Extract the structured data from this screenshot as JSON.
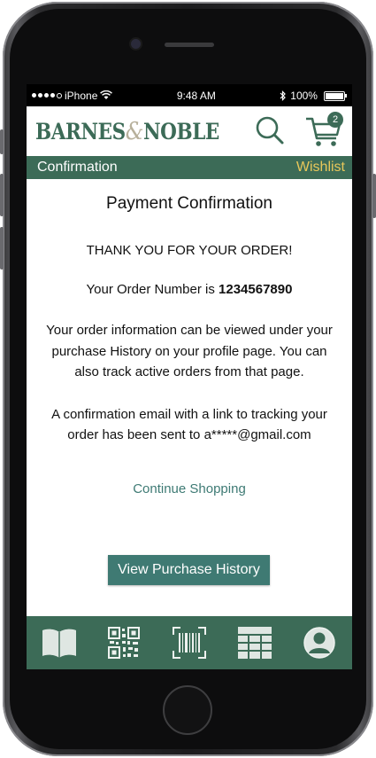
{
  "status_bar": {
    "carrier": "iPhone",
    "time": "9:48 AM",
    "battery": "100%"
  },
  "header": {
    "logo_part1": "BARNES",
    "logo_amp": "&",
    "logo_part2": "NOBLE",
    "cart_count": "2"
  },
  "subnav": {
    "title": "Confirmation",
    "wishlist": "Wishlist"
  },
  "main": {
    "title": "Payment Confirmation",
    "thanks": "THANK YOU FOR YOUR ORDER!",
    "order_label": "Your Order Number is",
    "order_number": "1234567890",
    "info": "Your order information can be viewed under your purchase History on your profile page. You can also track active orders from that page.",
    "email_note": "A confirmation email with a link to tracking your order has been sent to a*****@gmail.com",
    "continue_link": "Continue Shopping",
    "history_button": "View Purchase History"
  },
  "tabbar": {
    "icons": [
      "book-icon",
      "qr-code-icon",
      "barcode-icon",
      "grid-icon",
      "profile-icon"
    ]
  },
  "colors": {
    "brand_green": "#3c6b57",
    "wishlist_gold": "#e8c75a",
    "link_teal": "#3e7a74",
    "button_teal": "#3f7a73"
  }
}
